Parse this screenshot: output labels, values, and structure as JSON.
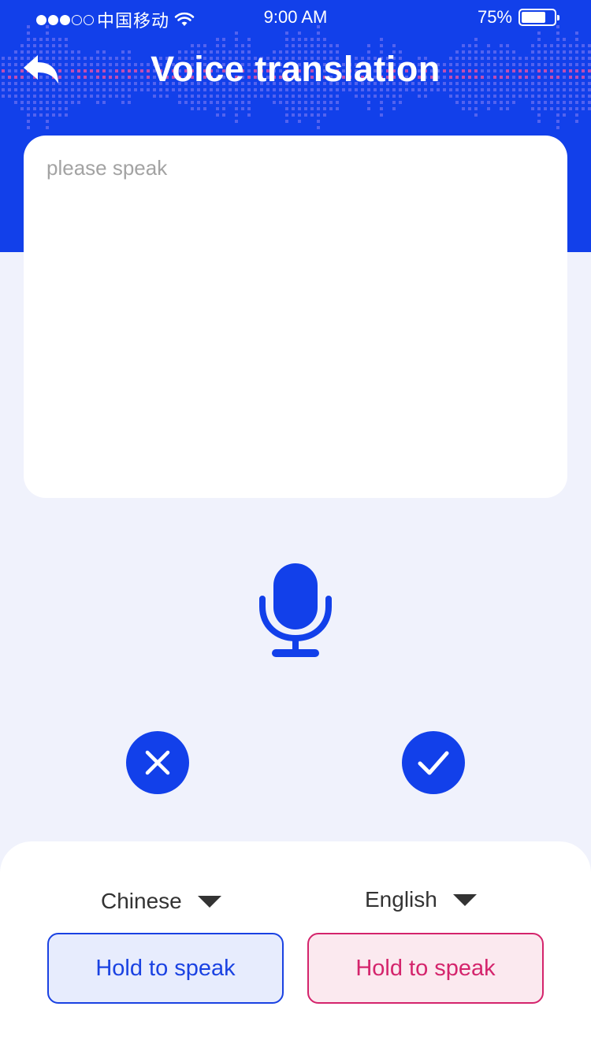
{
  "status_bar": {
    "carrier": "中国移动",
    "time": "9:00 AM",
    "battery": "75%",
    "battery_level": 0.75,
    "signal_strength": 3,
    "signal_max": 5
  },
  "header": {
    "title": "Voice translation",
    "back_icon": "back-arrow-icon"
  },
  "input": {
    "placeholder": "please speak",
    "value": ""
  },
  "recorder": {
    "mic_icon": "microphone-icon",
    "cancel_icon": "close-icon",
    "confirm_icon": "check-icon"
  },
  "languages": {
    "source": "Chinese",
    "target": "English"
  },
  "actions": {
    "hold_left": "Hold to speak",
    "hold_right": "Hold to speak"
  },
  "colors": {
    "primary": "#1240EA",
    "accent_pink": "#D4246C",
    "background": "#F0F2FC",
    "wave_start": "#2AA8E0",
    "wave_mid": "#A62BE6",
    "wave_end": "#EC3C8C"
  }
}
